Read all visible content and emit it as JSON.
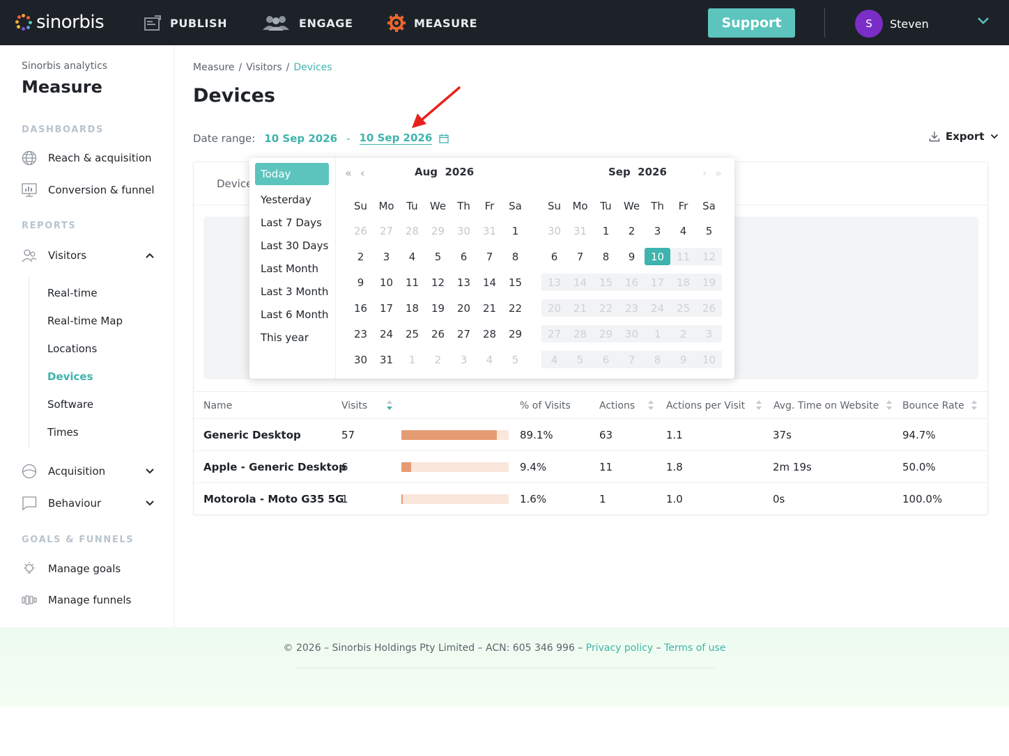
{
  "topnav": {
    "brand": "sinorbis",
    "items": [
      {
        "label": "PUBLISH",
        "icon": "publish-icon"
      },
      {
        "label": "ENGAGE",
        "icon": "engage-icon"
      },
      {
        "label": "MEASURE",
        "icon": "measure-icon"
      }
    ],
    "support_label": "Support",
    "user": {
      "initial": "S",
      "name": "Steven"
    }
  },
  "sidebar": {
    "subtitle": "Sinorbis analytics",
    "title": "Measure",
    "sections": {
      "dashboards": "DASHBOARDS",
      "reports": "REPORTS",
      "goals": "GOALS & FUNNELS"
    },
    "dashboards": [
      {
        "label": "Reach & acquisition",
        "icon": "globe-icon"
      },
      {
        "label": "Conversion & funnel",
        "icon": "monitor-chart-icon"
      }
    ],
    "visitors": {
      "label": "Visitors",
      "children": [
        "Real-time",
        "Real-time Map",
        "Locations",
        "Devices",
        "Software",
        "Times"
      ],
      "active": "Devices"
    },
    "acquisition": "Acquisition",
    "behaviour": "Behaviour",
    "goals": [
      {
        "label": "Manage goals",
        "icon": "lightbulb-icon"
      },
      {
        "label": "Manage funnels",
        "icon": "funnel-icon"
      }
    ]
  },
  "breadcrumb": [
    "Measure",
    "Visitors",
    "Devices"
  ],
  "page_title": "Devices",
  "date_range": {
    "label": "Date range:",
    "start": "10 Sep 2026",
    "sep": "-",
    "end": "10 Sep 2026"
  },
  "export_label": "Export",
  "card": {
    "tab_label": "Device"
  },
  "table": {
    "headers": [
      "Name",
      "Visits",
      "% of Visits",
      "Actions",
      "Actions per Visit",
      "Avg. Time on Website",
      "Bounce Rate"
    ],
    "rows": [
      {
        "name": "Generic Desktop",
        "visits": "57",
        "share": 0.891,
        "pct": "89.1%",
        "actions": "63",
        "apv": "1.1",
        "avg_time": "37s",
        "bounce": "94.7%"
      },
      {
        "name": "Apple - Generic Desktop",
        "visits": "6",
        "share": 0.094,
        "pct": "9.4%",
        "actions": "11",
        "apv": "1.8",
        "avg_time": "2m 19s",
        "bounce": "50.0%"
      },
      {
        "name": "Motorola - Moto G35 5G",
        "visits": "1",
        "share": 0.016,
        "pct": "1.6%",
        "actions": "1",
        "apv": "1.0",
        "avg_time": "0s",
        "bounce": "100.0%"
      }
    ]
  },
  "picker": {
    "presets": [
      "Today",
      "Yesterday",
      "Last 7 Days",
      "Last 30 Days",
      "Last Month",
      "Last 3 Month",
      "Last 6 Month",
      "This year"
    ],
    "active_preset": "Today",
    "weekdays": [
      "Su",
      "Mo",
      "Tu",
      "We",
      "Th",
      "Fr",
      "Sa"
    ],
    "left_month": {
      "month": "Aug",
      "year": "2026",
      "weeks": [
        [
          "26",
          "27",
          "28",
          "29",
          "30",
          "31",
          "1"
        ],
        [
          "2",
          "3",
          "4",
          "5",
          "6",
          "7",
          "8"
        ],
        [
          "9",
          "10",
          "11",
          "12",
          "13",
          "14",
          "15"
        ],
        [
          "16",
          "17",
          "18",
          "19",
          "20",
          "21",
          "22"
        ],
        [
          "23",
          "24",
          "25",
          "26",
          "27",
          "28",
          "29"
        ],
        [
          "30",
          "31",
          "1",
          "2",
          "3",
          "4",
          "5"
        ]
      ]
    },
    "right_month": {
      "month": "Sep",
      "year": "2026",
      "weeks": [
        [
          "30",
          "31",
          "1",
          "2",
          "3",
          "4",
          "5"
        ],
        [
          "6",
          "7",
          "8",
          "9",
          "10",
          "11",
          "12"
        ],
        [
          "13",
          "14",
          "15",
          "16",
          "17",
          "18",
          "19"
        ],
        [
          "20",
          "21",
          "22",
          "23",
          "24",
          "25",
          "26"
        ],
        [
          "27",
          "28",
          "29",
          "30",
          "1",
          "2",
          "3"
        ],
        [
          "4",
          "5",
          "6",
          "7",
          "8",
          "9",
          "10"
        ]
      ],
      "selected": "10"
    }
  },
  "footer": {
    "text": "© 2026 – Sinorbis Holdings Pty Limited – ACN: 605 346 996 –",
    "privacy": "Privacy policy",
    "dash": "–",
    "terms": "Terms of use"
  },
  "colors": {
    "accent": "#3fb3ad",
    "support": "#5cc4bd",
    "bar": "#e69c72",
    "bar_track": "#fbe6dc",
    "avatar": "#7b2ec7",
    "annotation_arrow": "#e8221b"
  }
}
